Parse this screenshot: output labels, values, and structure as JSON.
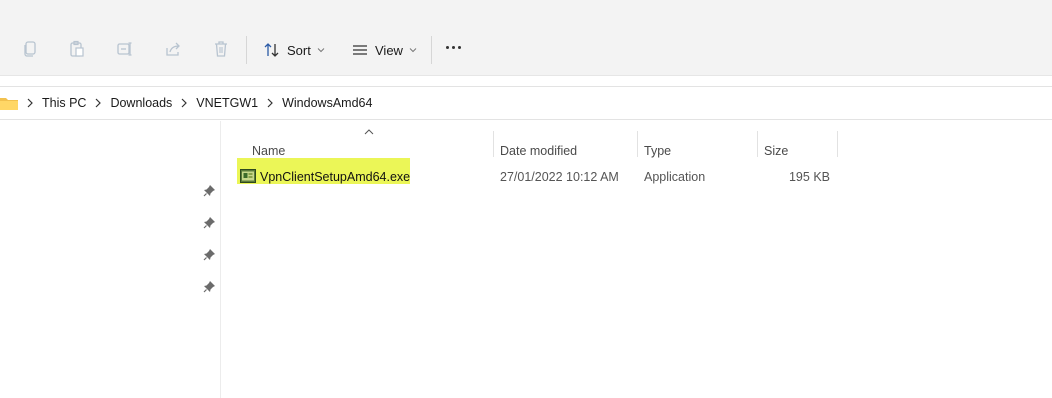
{
  "toolbar": {
    "sort_label": "Sort",
    "view_label": "View"
  },
  "breadcrumb": [
    "This PC",
    "Downloads",
    "VNETGW1",
    "WindowsAmd64"
  ],
  "columns": {
    "name": "Name",
    "date_modified": "Date modified",
    "type": "Type",
    "size": "Size"
  },
  "files": [
    {
      "name": "VpnClientSetupAmd64.exe",
      "date_modified": "27/01/2022 10:12 AM",
      "type": "Application",
      "size": "195 KB",
      "icon": "application-installer-icon",
      "highlight_color": "#e7f53a"
    }
  ]
}
